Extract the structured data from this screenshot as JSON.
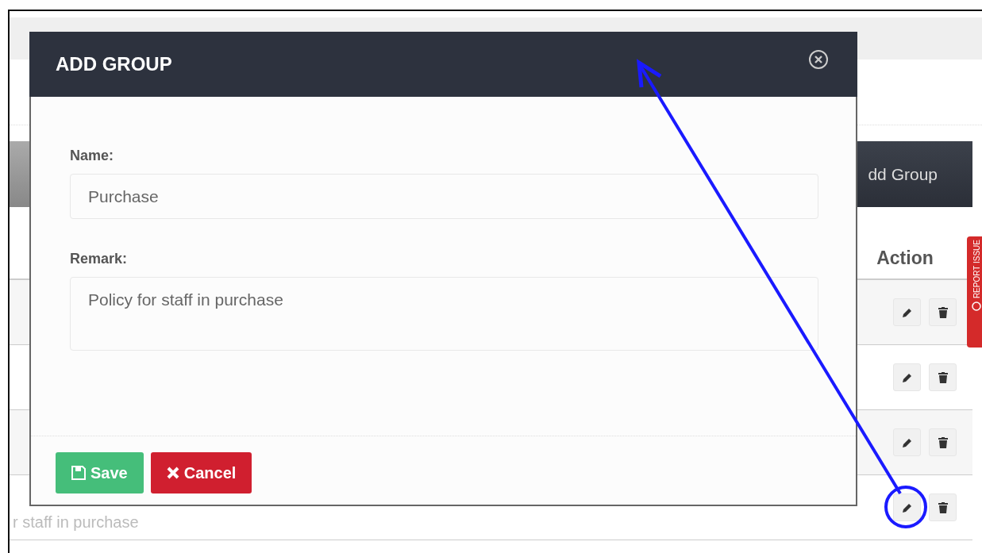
{
  "background_page": {
    "toolbar": {
      "add_button": {
        "label": "dd Group"
      }
    },
    "table": {
      "columns": [
        {
          "label": "Action"
        }
      ],
      "rows": [
        {
          "kind": "hidden",
          "circled": false
        },
        {
          "kind": "hidden",
          "circled": false
        },
        {
          "kind": "hidden",
          "circled": false
        },
        {
          "kind": "text",
          "text": "r staff in purchase",
          "circled": true
        }
      ]
    },
    "report_tab": {
      "label": "REPORT ISSUE"
    }
  },
  "dialog": {
    "title": "ADD GROUP",
    "fields": [
      {
        "kind": "input",
        "label": "Name:",
        "value": "Purchase"
      },
      {
        "kind": "textarea",
        "label": "Remark:",
        "value": "Policy for staff in purchase"
      }
    ],
    "buttons": [
      {
        "kind": "save",
        "label": "Save"
      },
      {
        "kind": "cancel",
        "label": "Cancel"
      }
    ]
  }
}
